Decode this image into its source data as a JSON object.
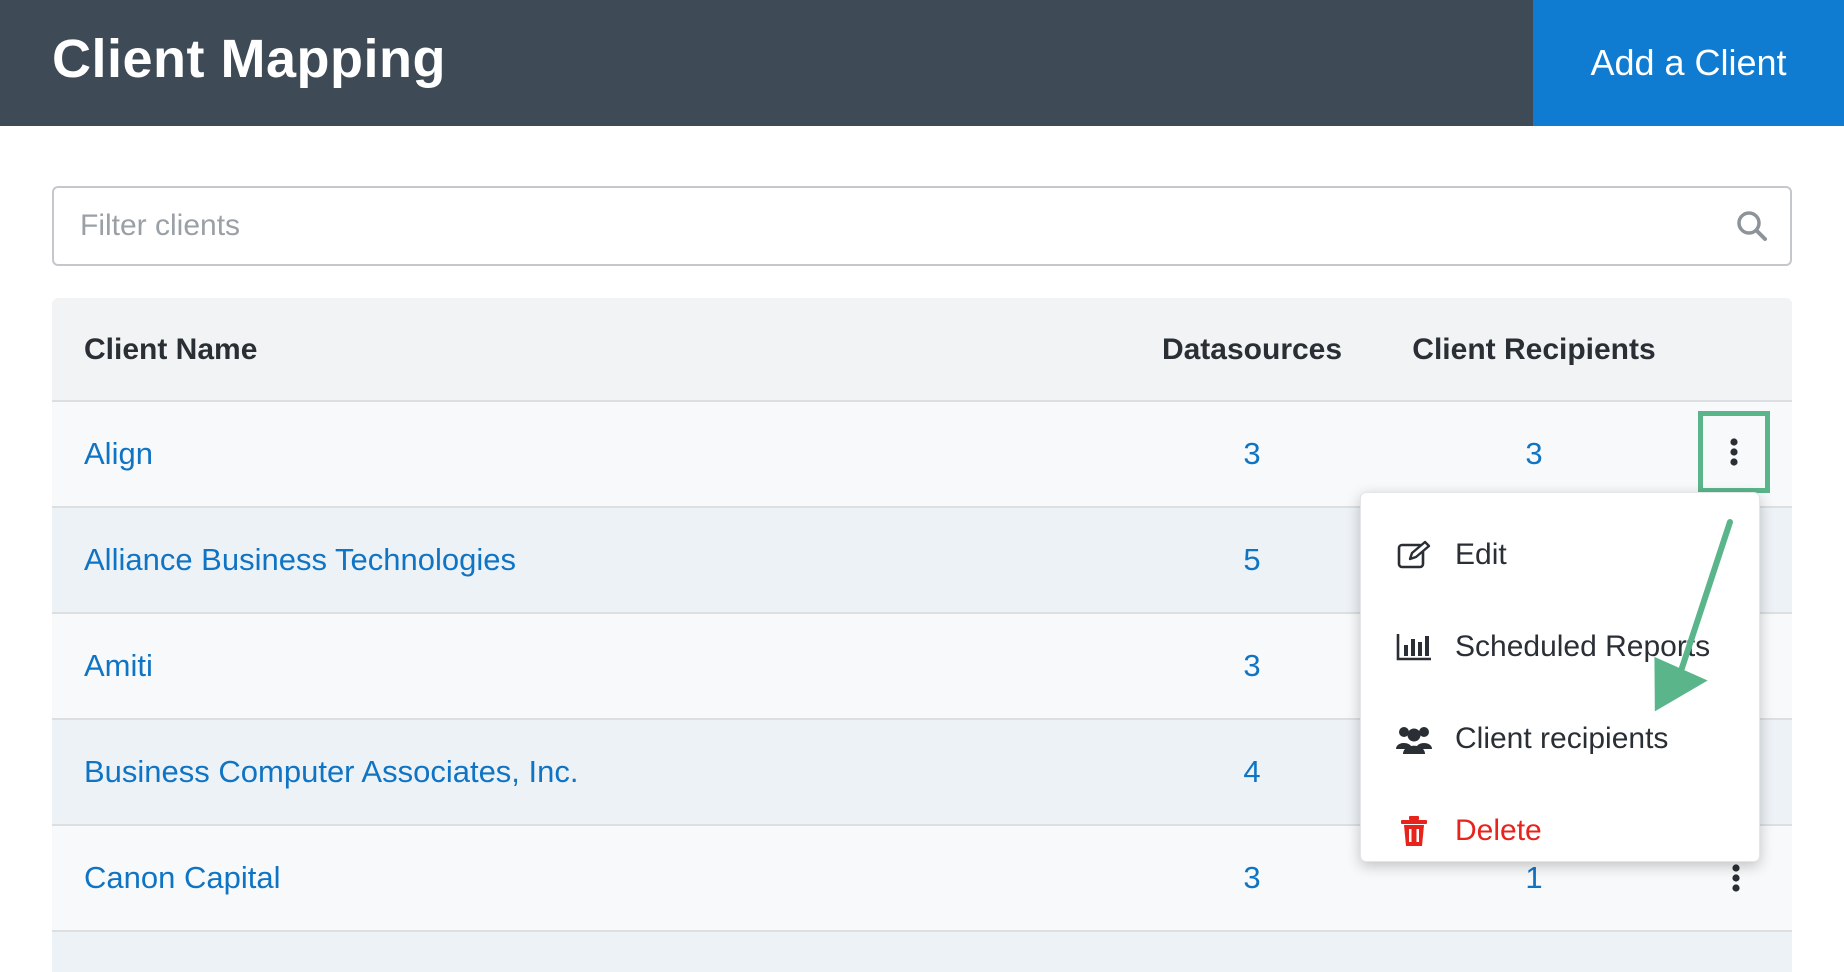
{
  "header": {
    "title": "Client Mapping",
    "add_button": "Add a Client"
  },
  "search": {
    "placeholder": "Filter clients",
    "value": ""
  },
  "table": {
    "columns": [
      "Client Name",
      "Datasources",
      "Client Recipients"
    ],
    "rows": [
      {
        "name": "Align",
        "datasources": "3",
        "recipients": "3"
      },
      {
        "name": "Alliance Business Technologies",
        "datasources": "5",
        "recipients": ""
      },
      {
        "name": "Amiti",
        "datasources": "3",
        "recipients": ""
      },
      {
        "name": "Business Computer Associates, Inc.",
        "datasources": "4",
        "recipients": ""
      },
      {
        "name": "Canon Capital",
        "datasources": "3",
        "recipients": "1"
      }
    ]
  },
  "menu": {
    "items": [
      {
        "label": "Edit",
        "icon": "edit-icon"
      },
      {
        "label": "Scheduled Reports",
        "icon": "bar-chart-icon"
      },
      {
        "label": "Client recipients",
        "icon": "users-icon"
      },
      {
        "label": "Delete",
        "icon": "trash-icon"
      }
    ]
  },
  "colors": {
    "header_bg": "#3f4a57",
    "accent": "#0f7bd1",
    "link": "#1074c4",
    "highlight": "#5bb58b",
    "danger": "#e8231c"
  }
}
